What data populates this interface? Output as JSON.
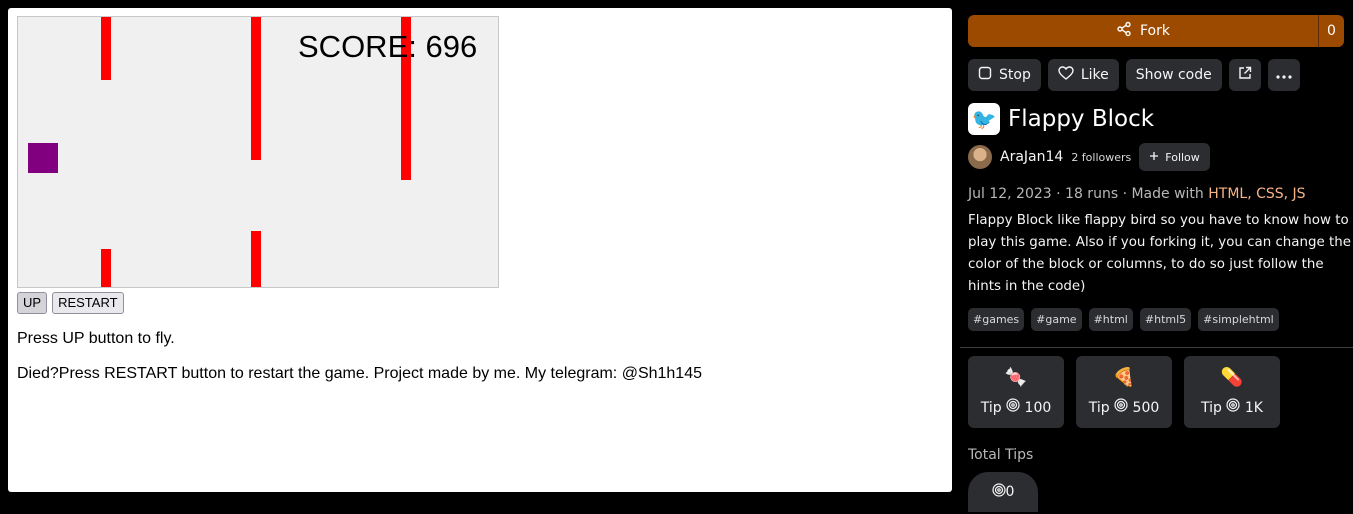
{
  "game": {
    "score_text": "SCORE: 696",
    "buttons": {
      "up": "UP",
      "restart": "RESTART"
    },
    "instructions": "Press UP button to fly.",
    "notes": "Died?Press RESTART button to restart the game. Project made by me. My telegram: @Sh1h145",
    "colors": {
      "pipe": "#ff0000",
      "block": "#800080",
      "background": "#f0f0f0"
    }
  },
  "sidebar": {
    "fork": {
      "label": "Fork",
      "count": "0"
    },
    "actions": {
      "stop": "Stop",
      "like": "Like",
      "show_code": "Show code"
    },
    "app": {
      "icon": "flappy-bird-icon",
      "title": "Flappy Block"
    },
    "author": {
      "name": "AraJan14",
      "followers": "2 followers",
      "follow_label": "Follow"
    },
    "meta": {
      "date": "Jul 12, 2023",
      "runs": "18 runs",
      "made_with": "Made with",
      "languages": "HTML, CSS, JS"
    },
    "description": "Flappy Block like flappy bird so you have to know how to play this game. Also if you forking it, you can change the color of the block or columns, to do so just follow the hints in the code)",
    "tags": [
      "#games",
      "#game",
      "#html",
      "#html5",
      "#simplehtml"
    ],
    "tips": [
      {
        "emoji": "🍬",
        "label": "Tip",
        "amount": "100"
      },
      {
        "emoji": "🍕",
        "label": "Tip",
        "amount": "500"
      },
      {
        "emoji": "💊",
        "label": "Tip",
        "amount": "1K"
      }
    ],
    "total_tips": {
      "label": "Total Tips",
      "amount": "0"
    },
    "colors": {
      "fork_button": "#9b4a00",
      "button_bg": "#2b2d31",
      "language_link": "#f7b38a"
    }
  }
}
